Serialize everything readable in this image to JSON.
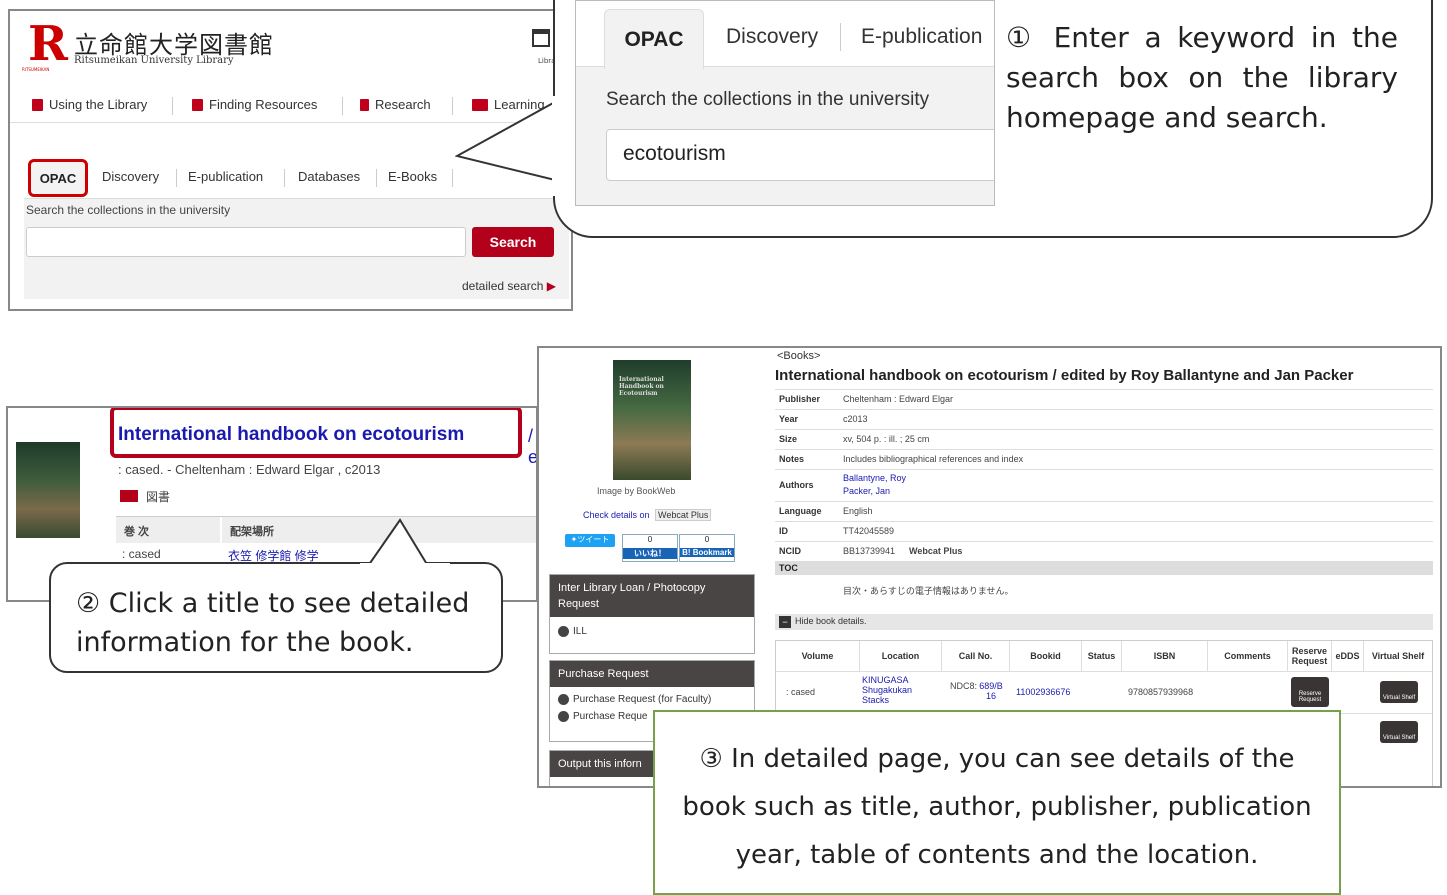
{
  "homepage": {
    "logo_mark": "R",
    "logo_sub": "RITSUMEIKAN",
    "logo_jp": "立命館大学図書館",
    "logo_en": "Ritsumeikan University Library",
    "calendar_label": "Library Sch",
    "nav": [
      "Using the Library",
      "Finding Resources",
      "Research",
      "Learning"
    ],
    "tabs": [
      "OPAC",
      "Discovery",
      "E-publication",
      "Databases",
      "E-Books"
    ],
    "search_title": "Search the collections in the university",
    "search_value": "",
    "search_button": "Search",
    "detailed_search": "detailed search"
  },
  "zoom": {
    "tabs": [
      "OPAC",
      "Discovery",
      "E-publication"
    ],
    "search_title": "Search the collections in the university",
    "search_value": "ecotourism"
  },
  "callout1": {
    "lines": [
      "① Enter a keyword in the",
      "search box on the library",
      "homepage and search."
    ]
  },
  "result": {
    "title": "International handbook on ecotourism",
    "title_rest": "/ e",
    "meta": ": cased. - Cheltenham : Edward Elgar , c2013",
    "type_label": "図書",
    "col_volume": "巻 次",
    "col_location": "配架場所",
    "cell_volume": ": cased",
    "cell_location": "衣笠 修学館 修学"
  },
  "callout2": {
    "lines": [
      "② Click a title to see detailed",
      "information for the book."
    ]
  },
  "detail": {
    "category": "<Books>",
    "title": "International handbook on ecotourism / edited by Roy Ballantyne and Jan Packer",
    "cover_title": "International Handbook on Ecotourism",
    "image_by": "Image by BookWeb",
    "check_details": "Check details on",
    "webcat": "Webcat Plus",
    "tweet": "ツイート",
    "like_count": "0",
    "like": "いいね！",
    "bookmark_count": "0",
    "bookmark": "B! Bookmark",
    "side": {
      "ill_header": "Inter Library Loan / Photocopy Request",
      "ill_item": "ILL",
      "purchase_header": "Purchase Request",
      "purchase_faculty": "Purchase Request (for Faculty)",
      "purchase_other": "Purchase Reque",
      "output_header": "Output this inforn"
    },
    "fields": [
      {
        "key": "Publisher",
        "value": "Cheltenham : Edward Elgar"
      },
      {
        "key": "Year",
        "value": "c2013"
      },
      {
        "key": "Size",
        "value": "xv, 504 p. : ill. ; 25 cm"
      },
      {
        "key": "Notes",
        "value": "Includes bibliographical references and index"
      },
      {
        "key": "Authors",
        "value": "Ballantyne, Roy",
        "value2": "Packer, Jan"
      },
      {
        "key": "Language",
        "value": "English"
      },
      {
        "key": "ID",
        "value": "TT42045589"
      },
      {
        "key": "NCID",
        "value": "BB13739941",
        "extra": "Webcat Plus"
      }
    ],
    "toc_label": "TOC",
    "toc_value": "目次・あらすじの電子情報はありません。",
    "hide_details": "Hide book details.",
    "holdings_cols": [
      "Volume",
      "Location",
      "Call No.",
      "Bookid",
      "Status",
      "ISBN",
      "Comments",
      "Reserve Request",
      "eDDS",
      "Virtual Shelf"
    ],
    "holding": {
      "volume": ": cased",
      "location": "KINUGASA Shugakukan Stacks",
      "call_prefix": "NDC8:",
      "call_no": "689/B 16",
      "bookid": "11002936676",
      "isbn": "9780857939968",
      "reserve": "Reserve Request",
      "shelf": "Virtual Shelf"
    }
  },
  "callout3": {
    "lines": [
      "③ In detailed page, you can see details of the",
      "book such as title, author, publisher, publication",
      "year, table of contents and the location."
    ]
  },
  "colors": {
    "accent": "#b3001b",
    "link": "#1a1ab0",
    "callout3_border": "#77a04a"
  }
}
